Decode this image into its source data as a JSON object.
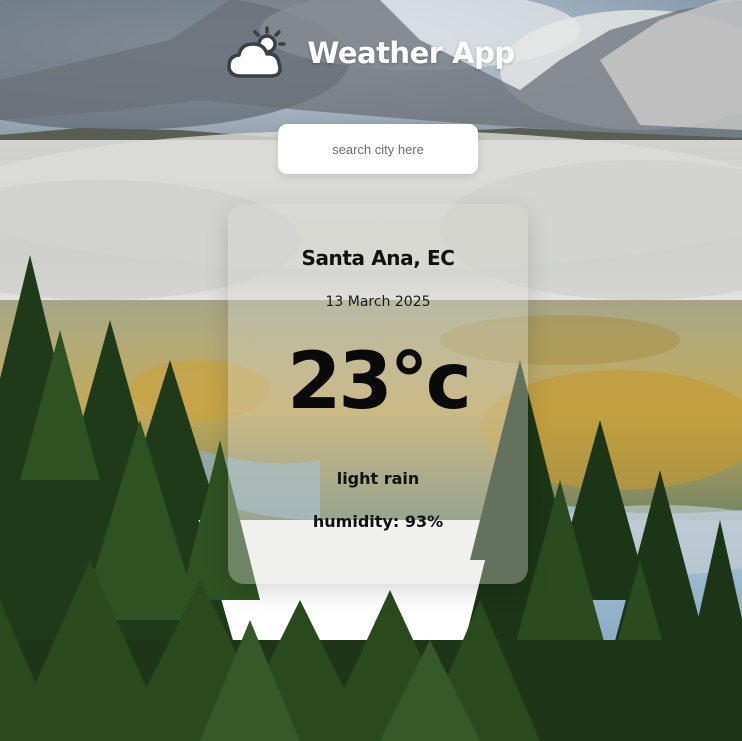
{
  "app": {
    "title": "Weather App",
    "logo_icon": "cloud-sun-icon"
  },
  "search": {
    "placeholder": "search city here",
    "value": ""
  },
  "weather": {
    "location": "Santa Ana, EC",
    "date": "13 March 2025",
    "temperature": "23°c",
    "description": "light rain",
    "humidity": "humidity: 93%"
  },
  "background": {
    "scene": "mountains-forest-fog",
    "sky_color": "#4a90d9",
    "forest_color": "#2d4a1f"
  }
}
